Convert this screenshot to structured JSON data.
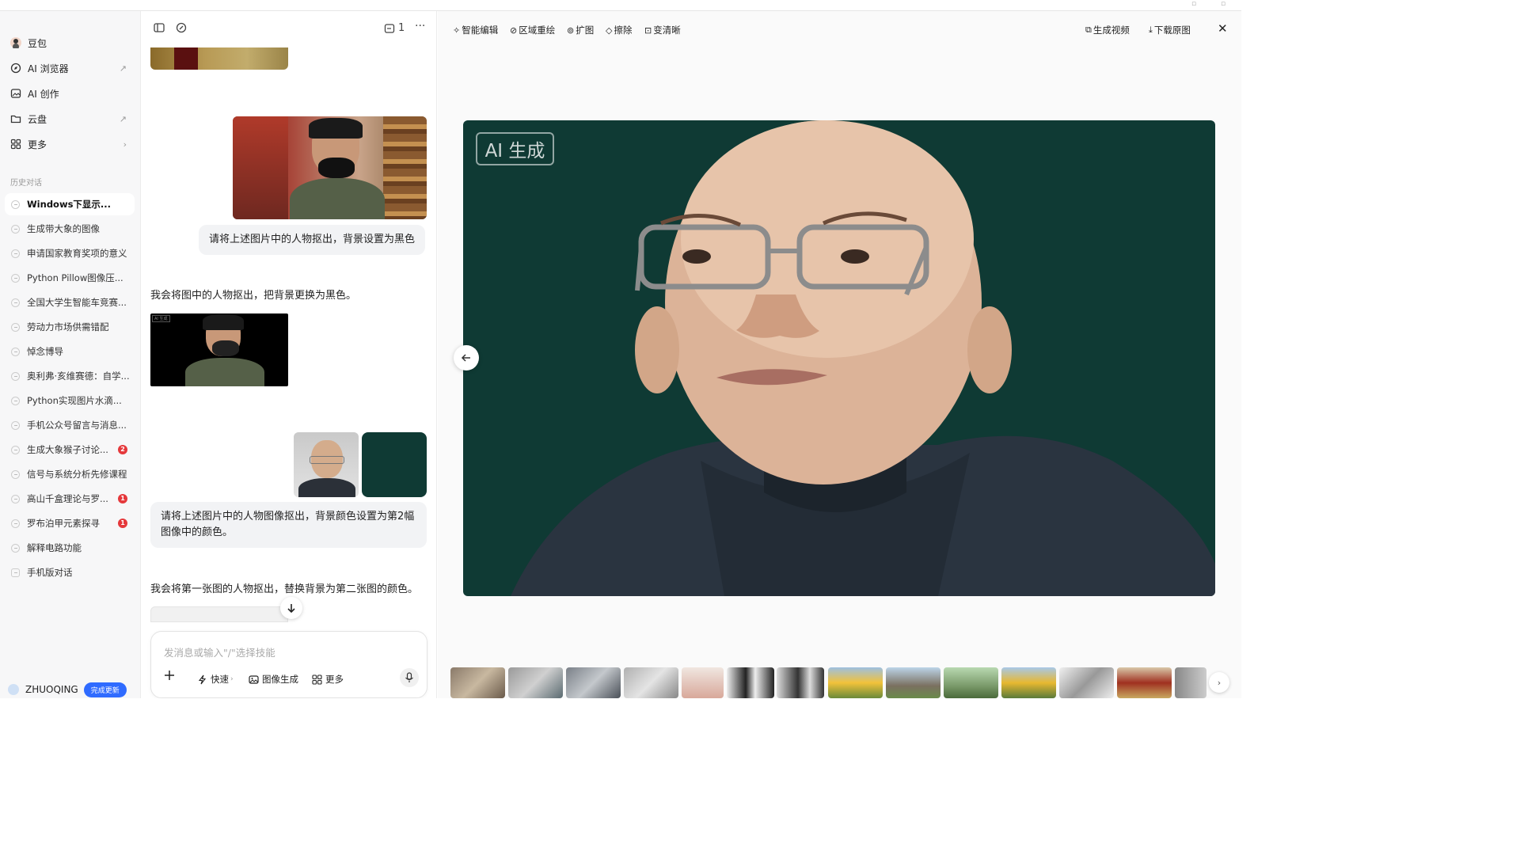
{
  "sidebar": {
    "nav": [
      {
        "label": "豆包",
        "icon": "doubao-avatar-icon"
      },
      {
        "label": "AI 浏览器",
        "icon": "compass-icon",
        "arrow": "↗"
      },
      {
        "label": "AI 创作",
        "icon": "image-icon"
      },
      {
        "label": "云盘",
        "icon": "folder-icon",
        "arrow": "↗"
      },
      {
        "label": "更多",
        "icon": "grid-icon",
        "arrow": "›"
      }
    ],
    "history_title": "历史对话",
    "history": [
      {
        "label": "Windows下显示..."
      },
      {
        "label": "生成带大象的图像"
      },
      {
        "label": "申请国家教育奖项的意义"
      },
      {
        "label": "Python Pillow图像压..."
      },
      {
        "label": "全国大学生智能车竞赛..."
      },
      {
        "label": "劳动力市场供需错配"
      },
      {
        "label": "悼念博导"
      },
      {
        "label": "奥利弗·亥维赛德：自学..."
      },
      {
        "label": "Python实现图片水滴..."
      },
      {
        "label": "手机公众号留言与消息..."
      },
      {
        "label": "生成大象猴子讨论...",
        "badge": "2"
      },
      {
        "label": "信号与系统分析先修课程"
      },
      {
        "label": "高山千盒理论与罗...",
        "badge": "1"
      },
      {
        "label": "罗布泊甲元素探寻",
        "badge": "1"
      },
      {
        "label": "解释电路功能"
      },
      {
        "label": "手机版对话"
      }
    ],
    "user": {
      "name": "ZHUOQING",
      "update_label": "完成更新"
    }
  },
  "chat": {
    "header": {
      "pages": "1"
    },
    "user_msg_1": "请将上述图片中的人物抠出，背景设置为黑色",
    "bot_reply_1": "我会将图中的人物抠出，把背景更换为黑色。",
    "user_msg_2": "请将上述图片中的人物图像抠出，背景颜色设置为第2幅图像中的颜色。",
    "bot_reply_2": "我会将第一张图的人物抠出，替换背景为第二张图的颜色。",
    "image_ai_tag": "AI 生成",
    "input_placeholder": "发消息或输入\"/\"选择技能",
    "tools": {
      "fast": "快速",
      "image_gen": "图像生成",
      "more": "更多"
    }
  },
  "viewer": {
    "toolbar": {
      "smart_edit": "智能编辑",
      "region_redraw": "区域重绘",
      "expand": "扩图",
      "erase": "擦除",
      "sharpen": "变清晰",
      "gen_video": "生成视频",
      "download": "下载原图"
    },
    "ai_tag": "AI 生成",
    "bg_color": "#0f3a34"
  }
}
